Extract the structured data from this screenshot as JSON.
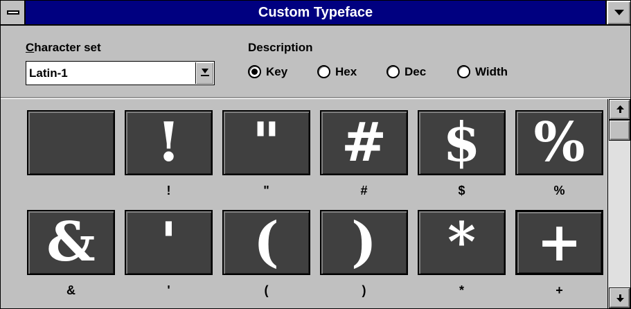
{
  "window": {
    "title": "Custom Typeface"
  },
  "options": {
    "character_set_label_prefix": "C",
    "character_set_label_rest": "haracter set",
    "character_set_value": "Latin-1",
    "description_label": "Description",
    "radios": [
      {
        "label": "Key",
        "checked": true
      },
      {
        "label": "Hex",
        "checked": false
      },
      {
        "label": "Dec",
        "checked": false
      },
      {
        "label": "Width",
        "checked": false
      }
    ]
  },
  "characters": [
    {
      "glyph": "",
      "label": ""
    },
    {
      "glyph": "!",
      "label": "!"
    },
    {
      "glyph": "\"",
      "label": "\""
    },
    {
      "glyph": "#",
      "label": "#"
    },
    {
      "glyph": "$",
      "label": "$"
    },
    {
      "glyph": "%",
      "label": "%"
    },
    {
      "glyph": "&",
      "label": "&"
    },
    {
      "glyph": "'",
      "label": "'"
    },
    {
      "glyph": "(",
      "label": "("
    },
    {
      "glyph": ")",
      "label": ")"
    },
    {
      "glyph": "*",
      "label": "*"
    },
    {
      "glyph": "+",
      "label": "+",
      "selected": true
    }
  ],
  "colors": {
    "titlebar": "#000080",
    "face": "#c0c0c0",
    "cell": "#404040"
  }
}
